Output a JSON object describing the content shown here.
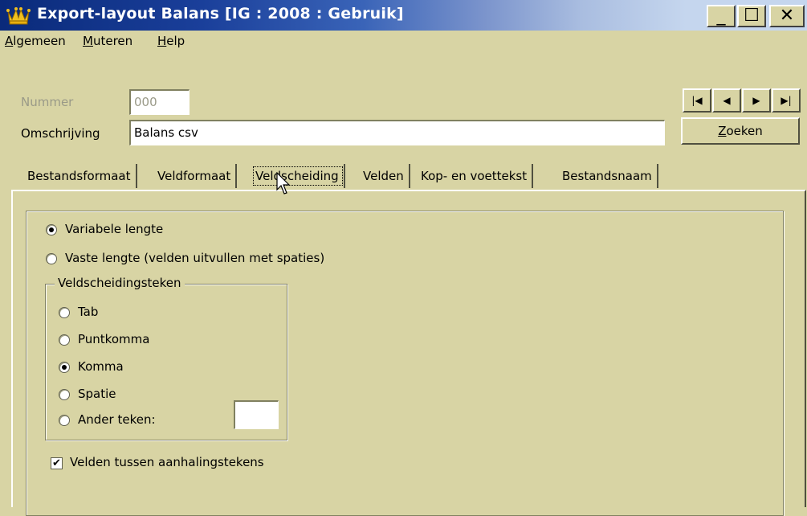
{
  "window": {
    "title": "Export-layout Balans  [IG : 2008 : Gebruik]",
    "controls": {
      "minimize": "_",
      "maximize": "☐",
      "close": "✕"
    }
  },
  "menu": {
    "algemeen": "Algemeen",
    "muteren": "Muteren",
    "help": "Help"
  },
  "fields": {
    "nummer_label": "Nummer",
    "nummer_value": "000",
    "omschrijving_label": "Omschrijving",
    "omschrijving_value": "Balans csv"
  },
  "nav": {
    "first": "|◀",
    "prev": "◀",
    "next": "▶",
    "last": "▶|",
    "zoeken": "Zoeken"
  },
  "tabs": [
    {
      "label": "Bestandsformaat"
    },
    {
      "label": "Veldformaat"
    },
    {
      "label": "Veldscheiding"
    },
    {
      "label": "Velden"
    },
    {
      "label": "Kop- en voettekst"
    },
    {
      "label": "Bestandsnaam"
    }
  ],
  "active_tab": "Veldscheiding",
  "lengte": {
    "variabel": "Variabele lengte",
    "vast": "Vaste lengte (velden uitvullen met spaties)",
    "selected": "variabel"
  },
  "veldscheidingsteken": {
    "legend": "Veldscheidingsteken",
    "options": [
      {
        "label": "Tab"
      },
      {
        "label": "Puntkomma"
      },
      {
        "label": "Komma"
      },
      {
        "label": "Spatie"
      },
      {
        "label": "Ander teken:"
      }
    ],
    "selected": "Komma",
    "ander_value": ""
  },
  "aanhalingstekens": {
    "label": "Velden tussen aanhalingstekens",
    "checked": true
  },
  "icons": {
    "app": "crown-icon",
    "checkmark": "✔"
  },
  "colors": {
    "face": "#d8d4a4",
    "title_start": "#0a2a7a",
    "title_end": "#c5d6ee"
  }
}
